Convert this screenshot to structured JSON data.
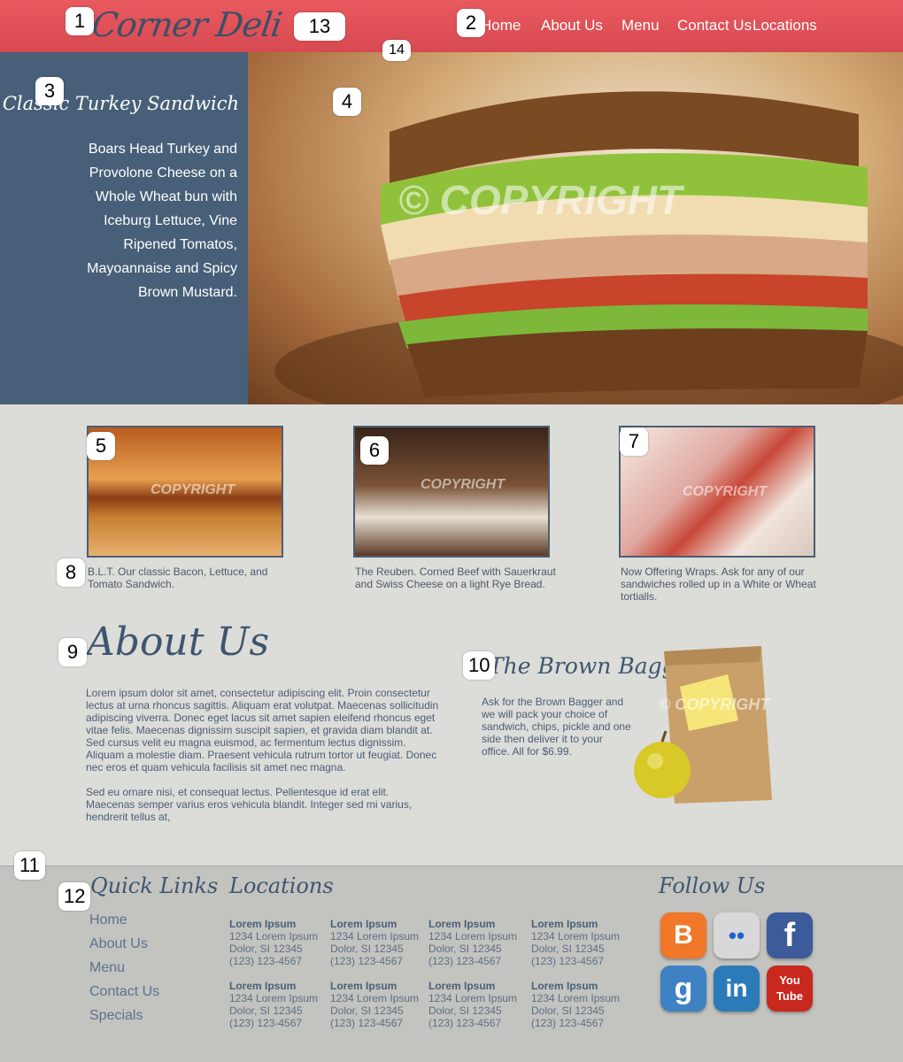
{
  "header": {
    "logo": "Corner Deli",
    "nav": [
      "Home",
      "About Us",
      "Menu",
      "Contact Us",
      "Locations"
    ]
  },
  "hero": {
    "title": "The Classic Turkey Sandwich",
    "description": "Boars Head Turkey and Provolone Cheese on a Whole Wheat bun with Iceburg Lettuce, Vine Ripened Tomatos, Mayoannaise and Spicy Brown Mustard.",
    "watermark": "© COPYRIGHT"
  },
  "thumbs": [
    {
      "caption": "B.L.T. Our classic Bacon, Lettuce, and Tomato Sandwich.",
      "watermark": "COPYRIGHT"
    },
    {
      "caption": "The Reuben.  Corned Beef with Sauerkraut and Swiss Cheese on a light Rye Bread.",
      "watermark": "COPYRIGHT"
    },
    {
      "caption": "Now Offering Wraps. Ask for any of our sandwiches rolled up in  a White or Wheat tortialls.",
      "watermark": "COPYRIGHT"
    }
  ],
  "about": {
    "title": "About Us",
    "paragraphs": [
      "Lorem ipsum dolor sit amet, consectetur adipiscing elit. Proin consectetur lectus at urna rhoncus sagittis. Aliquam erat volutpat. Maecenas sollicitudin adipiscing viverra. Donec eget lacus sit amet sapien eleifend rhoncus eget vitae felis. Maecenas dignissim suscipit sapien, et gravida diam blandit at. Sed cursus velit eu magna euismod, ac fermentum lectus dignissim. Aliquam a molestie diam. Praesent vehicula rutrum tortor ut feugiat. Donec nec eros et quam vehicula facilisis sit amet nec magna.",
      "Sed eu ornare nisi, et consequat lectus. Pellentesque id erat elit. Maecenas semper varius eros vehicula blandit. Integer sed mi varius, hendrerit tellus at,"
    ]
  },
  "bagger": {
    "title": "The Brown Bagger",
    "description": "Ask for the Brown Bagger and we will pack your choice of sandwich, chips, pickle and one side then deliver it to your office. All for $6.99.",
    "watermark": "© COPYRIGHT"
  },
  "footer": {
    "quick_links_title": "Quick Links",
    "quick_links": [
      "Home",
      "About Us",
      "Menu",
      "Contact Us",
      "Specials"
    ],
    "locations_title": "Locations",
    "locations": [
      {
        "name": "Lorem Ipsum",
        "address": "1234 Lorem Ipsum",
        "city": "Dolor, SI 12345",
        "phone": "(123) 123-4567"
      },
      {
        "name": "Lorem Ipsum",
        "address": "1234 Lorem Ipsum",
        "city": "Dolor, SI 12345",
        "phone": "(123) 123-4567"
      },
      {
        "name": "Lorem Ipsum",
        "address": "1234 Lorem Ipsum",
        "city": "Dolor, SI 12345",
        "phone": "(123) 123-4567"
      },
      {
        "name": "Lorem Ipsum",
        "address": "1234 Lorem Ipsum",
        "city": "Dolor, SI 12345",
        "phone": "(123) 123-4567"
      },
      {
        "name": "Lorem Ipsum",
        "address": "1234 Lorem Ipsum",
        "city": "Dolor, SI 12345",
        "phone": "(123) 123-4567"
      },
      {
        "name": "Lorem Ipsum",
        "address": "1234 Lorem Ipsum",
        "city": "Dolor, SI 12345",
        "phone": "(123) 123-4567"
      },
      {
        "name": "Lorem Ipsum",
        "address": "1234 Lorem Ipsum",
        "city": "Dolor, SI 12345",
        "phone": "(123) 123-4567"
      },
      {
        "name": "Lorem Ipsum",
        "address": "1234 Lorem Ipsum",
        "city": "Dolor, SI 12345",
        "phone": "(123) 123-4567"
      }
    ],
    "follow_title": "Follow Us",
    "social": [
      {
        "icon": "blogger-icon",
        "glyph": "B",
        "color": "#f07828"
      },
      {
        "icon": "flickr-icon",
        "glyph": "••",
        "color": "#d8d8d8"
      },
      {
        "icon": "facebook-icon",
        "glyph": "f",
        "color": "#3b5b9a"
      },
      {
        "icon": "google-icon",
        "glyph": "g",
        "color": "#3e82c4"
      },
      {
        "icon": "linkedin-icon",
        "glyph": "in",
        "color": "#2d7ab8"
      },
      {
        "icon": "youtube-icon",
        "glyph": "You Tube",
        "color": "#c8281e"
      }
    ]
  },
  "markers": [
    "1",
    "2",
    "3",
    "4",
    "5",
    "6",
    "7",
    "8",
    "9",
    "10",
    "11",
    "12",
    "13",
    "14"
  ]
}
